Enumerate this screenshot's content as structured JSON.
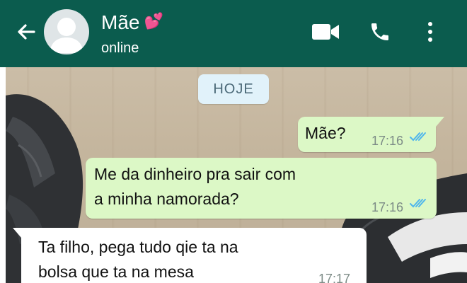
{
  "header": {
    "contact_name": "Mãe",
    "name_emoji": "💕",
    "status": "online",
    "colors": {
      "bar": "#0b5c4e",
      "text": "#ffffff"
    },
    "icons": [
      "back-arrow-icon",
      "avatar",
      "video-call-icon",
      "phone-icon",
      "more-vert-icon"
    ]
  },
  "chat": {
    "date_label": "HOJE",
    "messages": [
      {
        "direction": "out",
        "text_lines": [
          "Mãe?"
        ],
        "time": "17:16",
        "read": true
      },
      {
        "direction": "out",
        "text_lines": [
          "Me da dinheiro pra sair com",
          "a minha namorada?"
        ],
        "time": "17:16",
        "read": true
      },
      {
        "direction": "in",
        "text_lines": [
          "Ta filho, pega tudo qie ta na",
          "bolsa que ta na mesa"
        ],
        "time": "17:17"
      }
    ],
    "colors": {
      "outgoing": "#dcf8c6",
      "incoming": "#ffffff",
      "read_ticks": "#4fb6ec"
    }
  }
}
